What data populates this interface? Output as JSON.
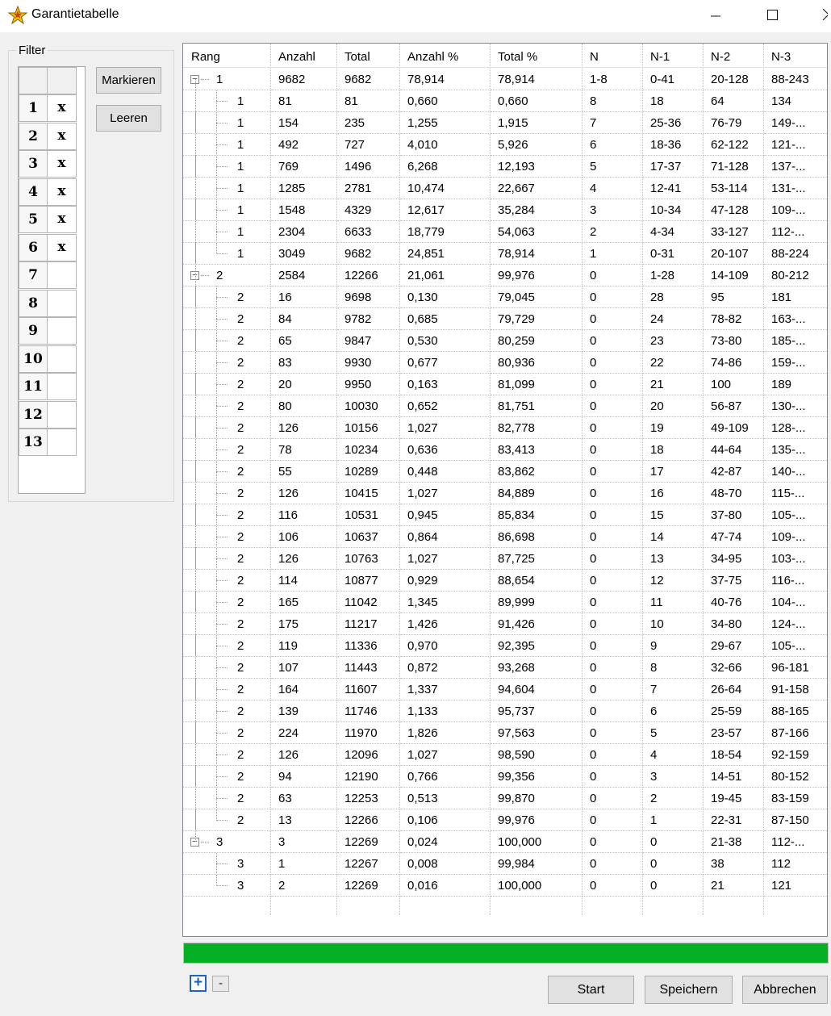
{
  "window": {
    "title": "Garantietabelle"
  },
  "filter": {
    "legend": "Filter",
    "rows": [
      {
        "num": "1",
        "mark": "x"
      },
      {
        "num": "2",
        "mark": "x"
      },
      {
        "num": "3",
        "mark": "x"
      },
      {
        "num": "4",
        "mark": "x"
      },
      {
        "num": "5",
        "mark": "x"
      },
      {
        "num": "6",
        "mark": "x"
      },
      {
        "num": "7",
        "mark": ""
      },
      {
        "num": "8",
        "mark": ""
      },
      {
        "num": "9",
        "mark": ""
      },
      {
        "num": "10",
        "mark": ""
      },
      {
        "num": "11",
        "mark": ""
      },
      {
        "num": "12",
        "mark": ""
      },
      {
        "num": "13",
        "mark": ""
      }
    ],
    "mark_button": "Markieren",
    "clear_button": "Leeren"
  },
  "table": {
    "columns": [
      "Rang",
      "Anzahl",
      "Total",
      "Anzahl %",
      "Total %",
      "N",
      "N-1",
      "N-2",
      "N-3"
    ],
    "rows": [
      {
        "level": 0,
        "rang": "1",
        "anzahl": "9682",
        "total": "9682",
        "anzahl_pct": "78,914",
        "total_pct": "78,914",
        "n": "1-8",
        "n1": "0-41",
        "n2": "20-128",
        "n3": "88-243"
      },
      {
        "level": 1,
        "rang": "1",
        "anzahl": "81",
        "total": "81",
        "anzahl_pct": "0,660",
        "total_pct": "0,660",
        "n": "8",
        "n1": "18",
        "n2": "64",
        "n3": "134"
      },
      {
        "level": 1,
        "rang": "1",
        "anzahl": "154",
        "total": "235",
        "anzahl_pct": "1,255",
        "total_pct": "1,915",
        "n": "7",
        "n1": "25-36",
        "n2": "76-79",
        "n3": "149-..."
      },
      {
        "level": 1,
        "rang": "1",
        "anzahl": "492",
        "total": "727",
        "anzahl_pct": "4,010",
        "total_pct": "5,926",
        "n": "6",
        "n1": "18-36",
        "n2": "62-122",
        "n3": "121-..."
      },
      {
        "level": 1,
        "rang": "1",
        "anzahl": "769",
        "total": "1496",
        "anzahl_pct": "6,268",
        "total_pct": "12,193",
        "n": "5",
        "n1": "17-37",
        "n2": "71-128",
        "n3": "137-..."
      },
      {
        "level": 1,
        "rang": "1",
        "anzahl": "1285",
        "total": "2781",
        "anzahl_pct": "10,474",
        "total_pct": "22,667",
        "n": "4",
        "n1": "12-41",
        "n2": "53-114",
        "n3": "131-..."
      },
      {
        "level": 1,
        "rang": "1",
        "anzahl": "1548",
        "total": "4329",
        "anzahl_pct": "12,617",
        "total_pct": "35,284",
        "n": "3",
        "n1": "10-34",
        "n2": "47-128",
        "n3": "109-..."
      },
      {
        "level": 1,
        "rang": "1",
        "anzahl": "2304",
        "total": "6633",
        "anzahl_pct": "18,779",
        "total_pct": "54,063",
        "n": "2",
        "n1": "4-34",
        "n2": "33-127",
        "n3": "112-..."
      },
      {
        "level": 1,
        "rang": "1",
        "anzahl": "3049",
        "total": "9682",
        "anzahl_pct": "24,851",
        "total_pct": "78,914",
        "n": "1",
        "n1": "0-31",
        "n2": "20-107",
        "n3": "88-224",
        "last": true
      },
      {
        "level": 0,
        "rang": "2",
        "anzahl": "2584",
        "total": "12266",
        "anzahl_pct": "21,061",
        "total_pct": "99,976",
        "n": "0",
        "n1": "1-28",
        "n2": "14-109",
        "n3": "80-212"
      },
      {
        "level": 1,
        "rang": "2",
        "anzahl": "16",
        "total": "9698",
        "anzahl_pct": "0,130",
        "total_pct": "79,045",
        "n": "0",
        "n1": "28",
        "n2": "95",
        "n3": "181"
      },
      {
        "level": 1,
        "rang": "2",
        "anzahl": "84",
        "total": "9782",
        "anzahl_pct": "0,685",
        "total_pct": "79,729",
        "n": "0",
        "n1": "24",
        "n2": "78-82",
        "n3": "163-..."
      },
      {
        "level": 1,
        "rang": "2",
        "anzahl": "65",
        "total": "9847",
        "anzahl_pct": "0,530",
        "total_pct": "80,259",
        "n": "0",
        "n1": "23",
        "n2": "73-80",
        "n3": "185-..."
      },
      {
        "level": 1,
        "rang": "2",
        "anzahl": "83",
        "total": "9930",
        "anzahl_pct": "0,677",
        "total_pct": "80,936",
        "n": "0",
        "n1": "22",
        "n2": "74-86",
        "n3": "159-..."
      },
      {
        "level": 1,
        "rang": "2",
        "anzahl": "20",
        "total": "9950",
        "anzahl_pct": "0,163",
        "total_pct": "81,099",
        "n": "0",
        "n1": "21",
        "n2": "100",
        "n3": "189"
      },
      {
        "level": 1,
        "rang": "2",
        "anzahl": "80",
        "total": "10030",
        "anzahl_pct": "0,652",
        "total_pct": "81,751",
        "n": "0",
        "n1": "20",
        "n2": "56-87",
        "n3": "130-..."
      },
      {
        "level": 1,
        "rang": "2",
        "anzahl": "126",
        "total": "10156",
        "anzahl_pct": "1,027",
        "total_pct": "82,778",
        "n": "0",
        "n1": "19",
        "n2": "49-109",
        "n3": "128-..."
      },
      {
        "level": 1,
        "rang": "2",
        "anzahl": "78",
        "total": "10234",
        "anzahl_pct": "0,636",
        "total_pct": "83,413",
        "n": "0",
        "n1": "18",
        "n2": "44-64",
        "n3": "135-..."
      },
      {
        "level": 1,
        "rang": "2",
        "anzahl": "55",
        "total": "10289",
        "anzahl_pct": "0,448",
        "total_pct": "83,862",
        "n": "0",
        "n1": "17",
        "n2": "42-87",
        "n3": "140-..."
      },
      {
        "level": 1,
        "rang": "2",
        "anzahl": "126",
        "total": "10415",
        "anzahl_pct": "1,027",
        "total_pct": "84,889",
        "n": "0",
        "n1": "16",
        "n2": "48-70",
        "n3": "115-..."
      },
      {
        "level": 1,
        "rang": "2",
        "anzahl": "116",
        "total": "10531",
        "anzahl_pct": "0,945",
        "total_pct": "85,834",
        "n": "0",
        "n1": "15",
        "n2": "37-80",
        "n3": "105-..."
      },
      {
        "level": 1,
        "rang": "2",
        "anzahl": "106",
        "total": "10637",
        "anzahl_pct": "0,864",
        "total_pct": "86,698",
        "n": "0",
        "n1": "14",
        "n2": "47-74",
        "n3": "109-..."
      },
      {
        "level": 1,
        "rang": "2",
        "anzahl": "126",
        "total": "10763",
        "anzahl_pct": "1,027",
        "total_pct": "87,725",
        "n": "0",
        "n1": "13",
        "n2": "34-95",
        "n3": "103-..."
      },
      {
        "level": 1,
        "rang": "2",
        "anzahl": "114",
        "total": "10877",
        "anzahl_pct": "0,929",
        "total_pct": "88,654",
        "n": "0",
        "n1": "12",
        "n2": "37-75",
        "n3": "116-..."
      },
      {
        "level": 1,
        "rang": "2",
        "anzahl": "165",
        "total": "11042",
        "anzahl_pct": "1,345",
        "total_pct": "89,999",
        "n": "0",
        "n1": "11",
        "n2": "40-76",
        "n3": "104-..."
      },
      {
        "level": 1,
        "rang": "2",
        "anzahl": "175",
        "total": "11217",
        "anzahl_pct": "1,426",
        "total_pct": "91,426",
        "n": "0",
        "n1": "10",
        "n2": "34-80",
        "n3": "124-..."
      },
      {
        "level": 1,
        "rang": "2",
        "anzahl": "119",
        "total": "11336",
        "anzahl_pct": "0,970",
        "total_pct": "92,395",
        "n": "0",
        "n1": "9",
        "n2": "29-67",
        "n3": "105-..."
      },
      {
        "level": 1,
        "rang": "2",
        "anzahl": "107",
        "total": "11443",
        "anzahl_pct": "0,872",
        "total_pct": "93,268",
        "n": "0",
        "n1": "8",
        "n2": "32-66",
        "n3": "96-181"
      },
      {
        "level": 1,
        "rang": "2",
        "anzahl": "164",
        "total": "11607",
        "anzahl_pct": "1,337",
        "total_pct": "94,604",
        "n": "0",
        "n1": "7",
        "n2": "26-64",
        "n3": "91-158"
      },
      {
        "level": 1,
        "rang": "2",
        "anzahl": "139",
        "total": "11746",
        "anzahl_pct": "1,133",
        "total_pct": "95,737",
        "n": "0",
        "n1": "6",
        "n2": "25-59",
        "n3": "88-165"
      },
      {
        "level": 1,
        "rang": "2",
        "anzahl": "224",
        "total": "11970",
        "anzahl_pct": "1,826",
        "total_pct": "97,563",
        "n": "0",
        "n1": "5",
        "n2": "23-57",
        "n3": "87-166"
      },
      {
        "level": 1,
        "rang": "2",
        "anzahl": "126",
        "total": "12096",
        "anzahl_pct": "1,027",
        "total_pct": "98,590",
        "n": "0",
        "n1": "4",
        "n2": "18-54",
        "n3": "92-159"
      },
      {
        "level": 1,
        "rang": "2",
        "anzahl": "94",
        "total": "12190",
        "anzahl_pct": "0,766",
        "total_pct": "99,356",
        "n": "0",
        "n1": "3",
        "n2": "14-51",
        "n3": "80-152"
      },
      {
        "level": 1,
        "rang": "2",
        "anzahl": "63",
        "total": "12253",
        "anzahl_pct": "0,513",
        "total_pct": "99,870",
        "n": "0",
        "n1": "2",
        "n2": "19-45",
        "n3": "83-159"
      },
      {
        "level": 1,
        "rang": "2",
        "anzahl": "13",
        "total": "12266",
        "anzahl_pct": "0,106",
        "total_pct": "99,976",
        "n": "0",
        "n1": "1",
        "n2": "22-31",
        "n3": "87-150",
        "last": true
      },
      {
        "level": 0,
        "rang": "3",
        "anzahl": "3",
        "total": "12269",
        "anzahl_pct": "0,024",
        "total_pct": "100,000",
        "n": "0",
        "n1": "0",
        "n2": "21-38",
        "n3": "112-...",
        "last_top": true
      },
      {
        "level": 1,
        "rang": "3",
        "anzahl": "1",
        "total": "12267",
        "anzahl_pct": "0,008",
        "total_pct": "99,984",
        "n": "0",
        "n1": "0",
        "n2": "38",
        "n3": "112",
        "parent_last": true
      },
      {
        "level": 1,
        "rang": "3",
        "anzahl": "2",
        "total": "12269",
        "anzahl_pct": "0,016",
        "total_pct": "100,000",
        "n": "0",
        "n1": "0",
        "n2": "21",
        "n3": "121",
        "last": true,
        "parent_last": true
      }
    ]
  },
  "scrollbar": {
    "left_arrow": "<",
    "right_arrow": ">"
  },
  "progress": {
    "value_pct": 100,
    "color": "#06b025"
  },
  "tree_controls": {
    "expand": "+",
    "collapse": "-"
  },
  "buttons": {
    "start": "Start",
    "save": "Speichern",
    "cancel": "Abbrechen"
  },
  "icons": {
    "app": "star-app-icon"
  }
}
